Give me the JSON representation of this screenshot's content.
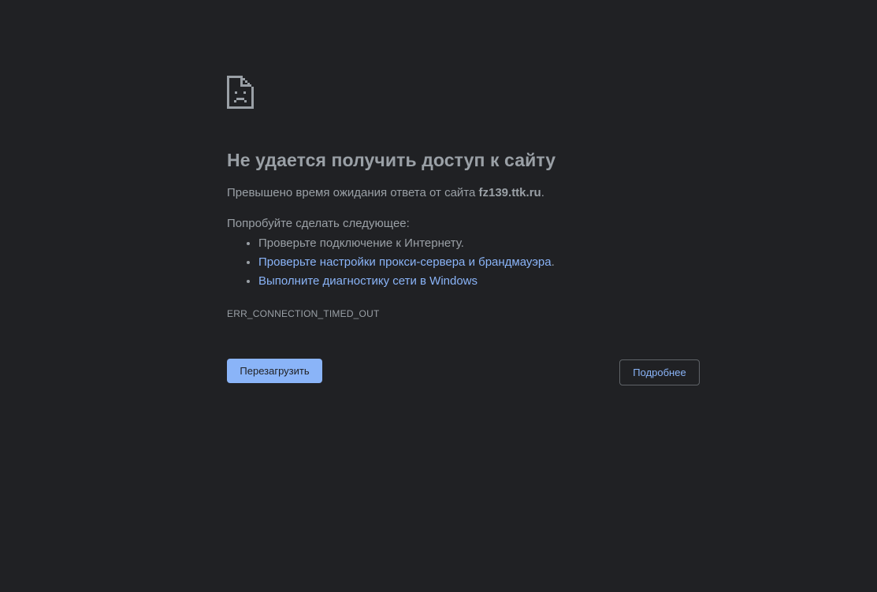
{
  "error_page": {
    "icon": "sad-document-icon",
    "title": "Не удается получить доступ к сайту",
    "subtitle_prefix": "Превышено время ожидания ответа от сайта ",
    "host": "fz139.ttk.ru",
    "subtitle_suffix": ".",
    "suggestions_intro": "Попробуйте сделать следующее:",
    "suggestions": [
      {
        "text": "Проверьте подключение к Интернету.",
        "is_link": false
      },
      {
        "text": "Проверьте настройки прокси-сервера и брандмауэра",
        "is_link": true,
        "suffix": "."
      },
      {
        "text": "Выполните диагностику сети в Windows",
        "is_link": true,
        "suffix": ""
      }
    ],
    "error_code": "ERR_CONNECTION_TIMED_OUT"
  },
  "buttons": {
    "reload_label": "Перезагрузить",
    "details_label": "Подробнее"
  },
  "colors": {
    "background": "#202124",
    "text": "#9aa0a6",
    "link": "#8ab4f8",
    "primary_button": "#8ab4f8"
  }
}
